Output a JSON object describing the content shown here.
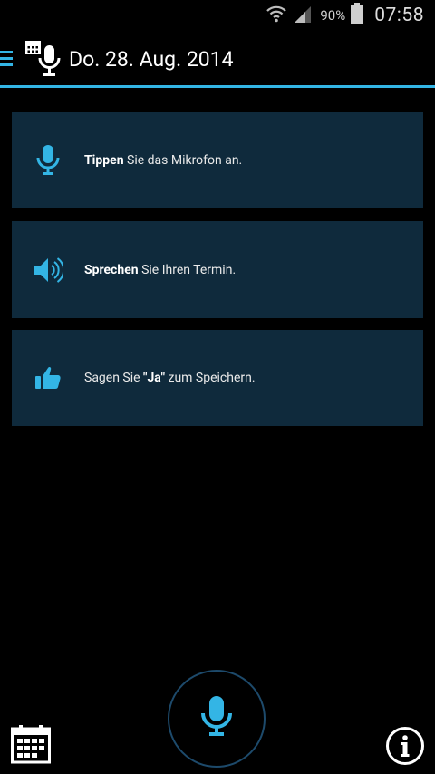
{
  "status_bar": {
    "battery_percent": "90%",
    "time": "07:58",
    "icons": [
      "wifi-icon",
      "signal-icon",
      "battery-icon"
    ]
  },
  "action_bar": {
    "date": "Do. 28. Aug. 2014",
    "icons": [
      "menu-icon",
      "app-logo-icon"
    ]
  },
  "steps": [
    {
      "icon": "microphone-icon",
      "bold": "Tippen",
      "pre": "",
      "rest": " Sie das Mikrofon an."
    },
    {
      "icon": "speaker-icon",
      "bold": "Sprechen",
      "pre": "",
      "rest": " Sie Ihren Termin."
    },
    {
      "icon": "thumbs-up-icon",
      "pre": "Sagen Sie ",
      "bold": "\"Ja\"",
      "rest": " zum Speichern."
    }
  ],
  "bottom_bar": {
    "icons": [
      "calendar-icon",
      "microphone-button",
      "info-icon"
    ]
  },
  "colors": {
    "accent": "#33b5e5",
    "card_bg": "#0f2a3c"
  }
}
